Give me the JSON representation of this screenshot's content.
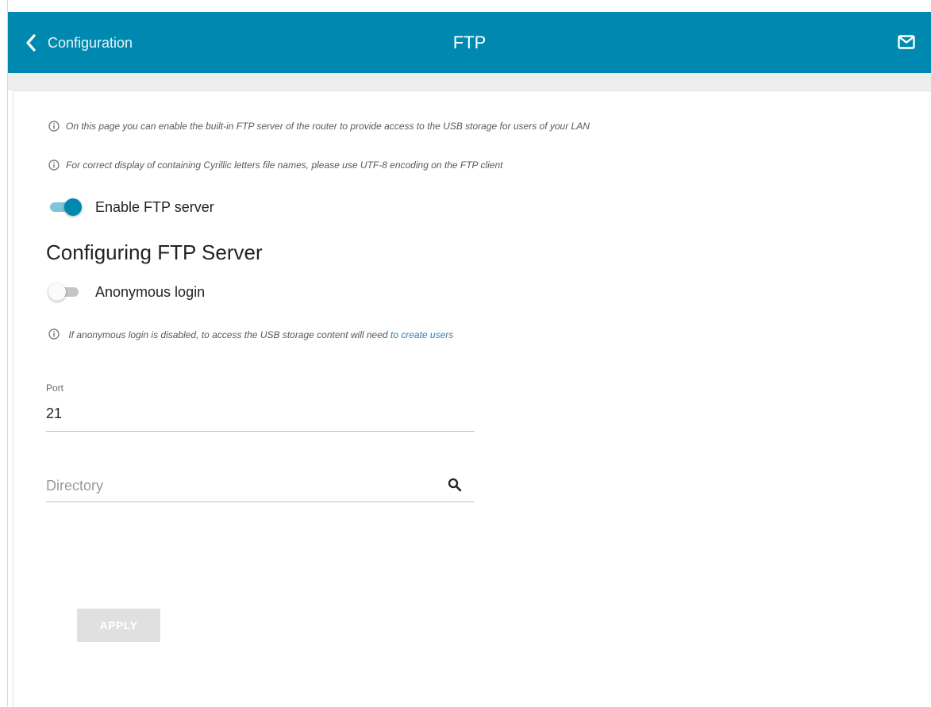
{
  "header": {
    "back_label": "Configuration",
    "title": "FTP",
    "back_icon": "chevron-left-icon",
    "mail_icon": "mail-icon"
  },
  "info": {
    "line1": "On this page you can enable the built-in FTP server of the router to provide access to the USB storage for users of your LAN",
    "line2": "For correct display of containing Cyrillic letters file names, please use UTF-8 encoding on the FTP client",
    "anon_text": "If anonymous login is disabled, to access the USB storage content will need ",
    "anon_link": "to create users"
  },
  "enable_ftp": {
    "label": "Enable FTP server",
    "checked": true
  },
  "section_title": "Configuring FTP Server",
  "anonymous": {
    "label": "Anonymous login",
    "checked": false
  },
  "port": {
    "label": "Port",
    "value": "21"
  },
  "directory": {
    "placeholder": "Directory",
    "value": ""
  },
  "apply_label": "APPLY",
  "colors": {
    "header": "#0089b0",
    "toggle_on": "#0089b0",
    "link": "#2a7fb8",
    "apply_disabled": "#e0e0e0"
  }
}
